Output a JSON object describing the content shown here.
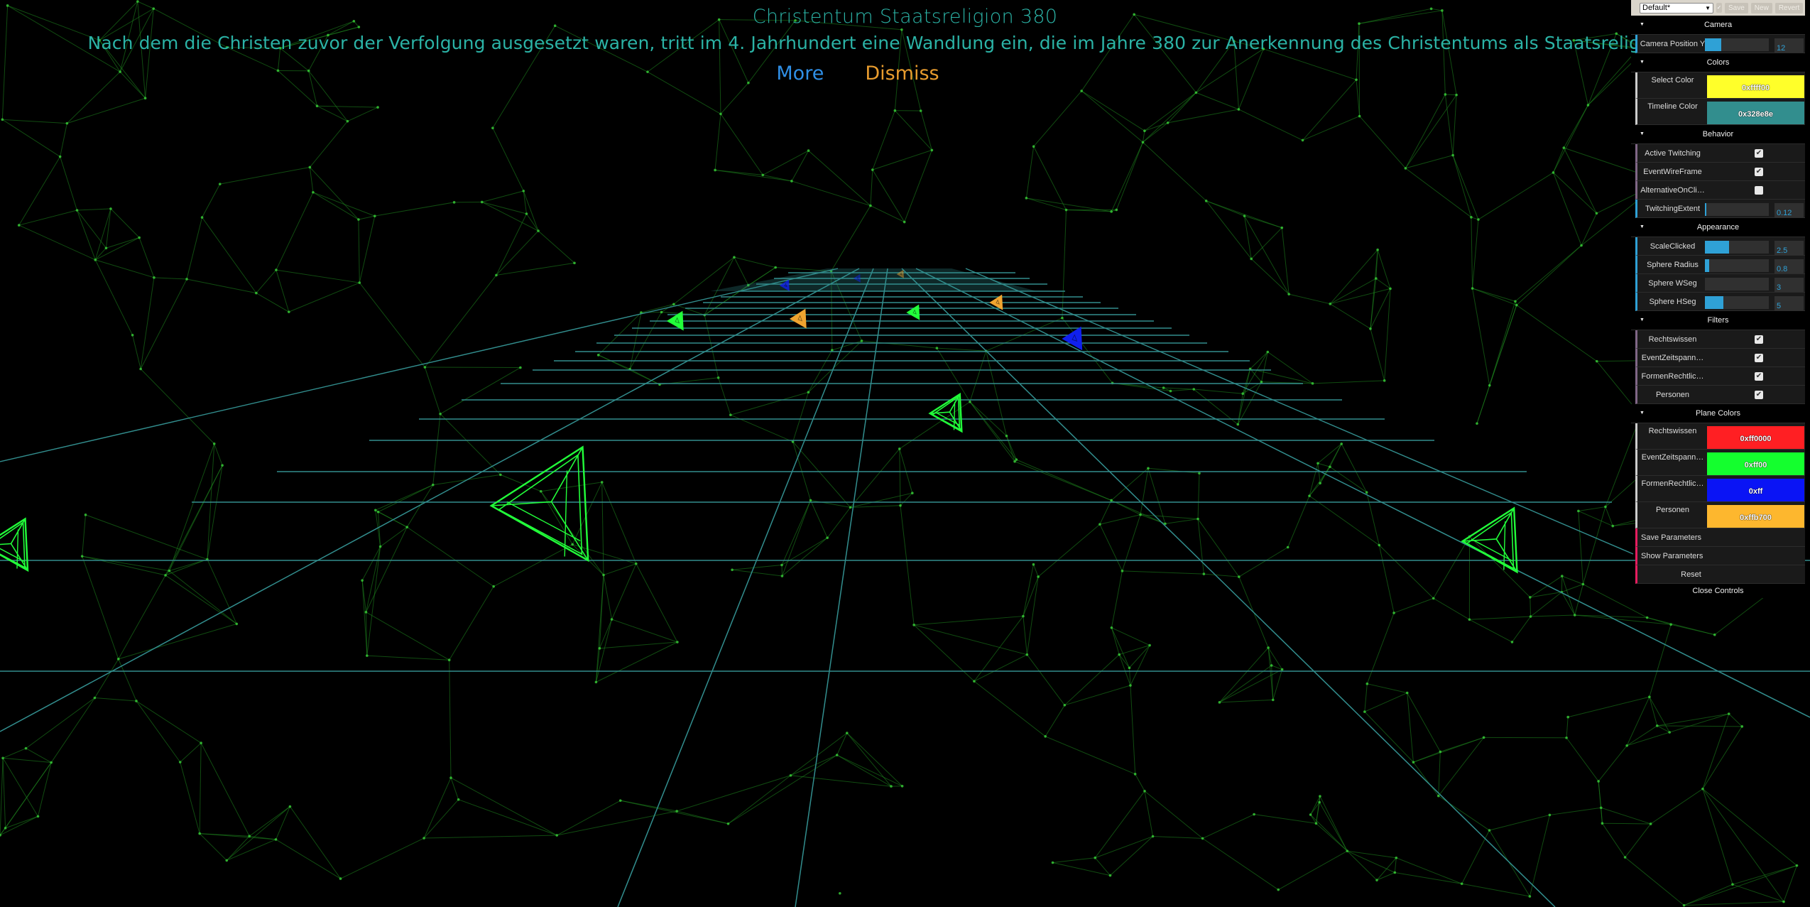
{
  "event": {
    "title": "Christentum Staatsreligion 380",
    "description": "Nach dem die Christen zuvor der Verfolgung ausgesetzt waren, tritt im 4. Jahrhundert eine Wandlung ein, die im Jahre 380 zur Anerkennung des Christentums als Staatsreligion führt.",
    "more_label": "More",
    "dismiss_label": "Dismiss"
  },
  "gui": {
    "preset": "Default*",
    "save_label": "Save",
    "new_label": "New",
    "revert_label": "Revert",
    "close_label": "Close Controls",
    "camera": {
      "title": "Camera",
      "position_y": {
        "label": "Camera Position Y",
        "value": "12",
        "fill": 0.25
      }
    },
    "colors": {
      "title": "Colors",
      "select": {
        "label": "Select Color",
        "value": "0xffff00",
        "hex": "#ffff2a"
      },
      "timeline": {
        "label": "Timeline Color",
        "value": "0x328e8e",
        "hex": "#328e8e"
      }
    },
    "behavior": {
      "title": "Behavior",
      "active_twitching": {
        "label": "Active Twitching",
        "checked": true
      },
      "event_wireframe": {
        "label": "EventWireFrame",
        "checked": true
      },
      "alternative_on_click": {
        "label": "AlternativeOnCli…",
        "checked": false
      },
      "twitching_extent": {
        "label": "TwitchingExtent",
        "value": "0.12",
        "fill": 0.02
      }
    },
    "appearance": {
      "title": "Appearance",
      "scale_clicked": {
        "label": "ScaleClicked",
        "value": "2.5",
        "fill": 0.38
      },
      "sphere_radius": {
        "label": "Sphere Radius",
        "value": "0.8",
        "fill": 0.07
      },
      "sphere_wseg": {
        "label": "Sphere WSeg",
        "value": "3",
        "fill": 0.0
      },
      "sphere_hseg": {
        "label": "Sphere HSeg",
        "value": "5",
        "fill": 0.29
      }
    },
    "filters": {
      "title": "Filters",
      "items": [
        {
          "label": "Rechtswissen",
          "checked": true
        },
        {
          "label": "EventZeitspann…",
          "checked": true
        },
        {
          "label": "FormenRechtlic…",
          "checked": true
        },
        {
          "label": "Personen",
          "checked": true
        }
      ]
    },
    "plane_colors": {
      "title": "Plane Colors",
      "items": [
        {
          "label": "Rechtswissen",
          "value": "0xff0000",
          "hex": "#ff1f23"
        },
        {
          "label": "EventZeitspann…",
          "value": "0xff00",
          "hex": "#14ff2e"
        },
        {
          "label": "FormenRechtlic…",
          "value": "0xff",
          "hex": "#0a14f5"
        },
        {
          "label": "Personen",
          "value": "0xffb700",
          "hex": "#fdb72e"
        }
      ]
    },
    "actions": {
      "save_parameters": "Save Parameters",
      "show_parameters": "Show Parameters",
      "reset": "Reset"
    }
  },
  "scene": {
    "timeline_color": "#328e8e",
    "network_color": "#1f8a1f",
    "markers": [
      {
        "category": "EventZeitspann…",
        "color": "#22ff3a",
        "size": "large"
      },
      {
        "category": "EventZeitspann…",
        "color": "#22ff3a",
        "size": "large"
      },
      {
        "category": "EventZeitspann…",
        "color": "#22ff3a",
        "size": "large"
      },
      {
        "category": "EventZeitspann…",
        "color": "#22ff3a",
        "size": "medium"
      },
      {
        "category": "EventZeitspann…",
        "color": "#22ff3a",
        "size": "small"
      },
      {
        "category": "EventZeitspann…",
        "color": "#22ff3a",
        "size": "small"
      },
      {
        "category": "Personen",
        "color": "#f0a530",
        "size": "small"
      },
      {
        "category": "Personen",
        "color": "#f0a530",
        "size": "small"
      },
      {
        "category": "FormenRechtlic…",
        "color": "#1020ee",
        "size": "small"
      },
      {
        "category": "FormenRechtlic…",
        "color": "#1020ee",
        "size": "tiny"
      }
    ]
  }
}
